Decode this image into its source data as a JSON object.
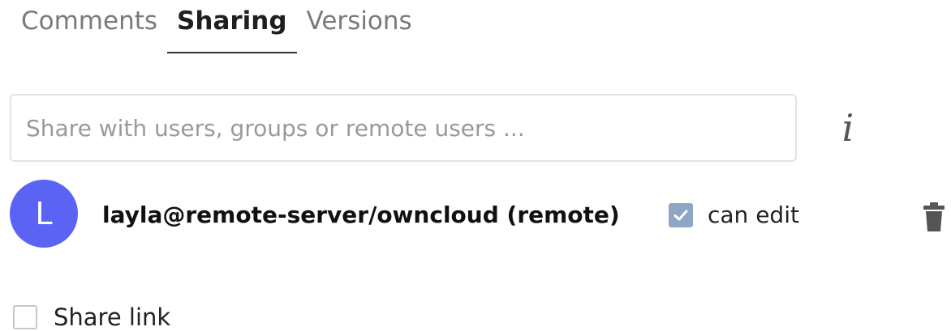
{
  "tabs": [
    {
      "label": "Comments",
      "active": false
    },
    {
      "label": "Sharing",
      "active": true
    },
    {
      "label": "Versions",
      "active": false
    }
  ],
  "share_input": {
    "value": "",
    "placeholder": "Share with users, groups or remote users ..."
  },
  "info_icon": {
    "glyph": "i",
    "icon": "info-icon"
  },
  "shares": [
    {
      "avatar_letter": "L",
      "avatar_color": "#5b63f4",
      "user": "layla@remote-server/owncloud (remote)",
      "permission_label": "can edit",
      "permission_checked": true,
      "delete_icon": "trash-icon"
    }
  ],
  "share_link": {
    "label": "Share link",
    "checked": false
  },
  "colors": {
    "accent": "#5b63f4",
    "checkbox_checked": "#8ea5c3",
    "muted_text": "#7a7a7a"
  }
}
